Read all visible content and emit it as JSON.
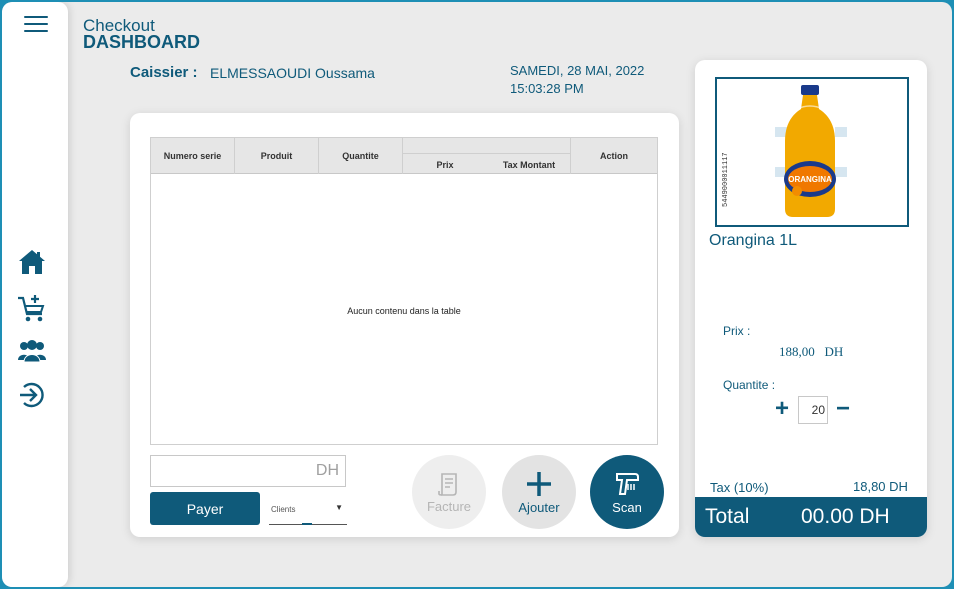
{
  "header": {
    "title_small": "Checkout",
    "title_big": "DASHBOARD",
    "cashier_label": "Caissier :",
    "cashier_name": "ELMESSAOUDI Oussama",
    "date": "SAMEDI, 28 MAI, 2022",
    "time": "15:03:28 PM"
  },
  "sidebar": {
    "items": [
      {
        "icon": "menu-icon"
      },
      {
        "icon": "home-icon"
      },
      {
        "icon": "cart-add-icon"
      },
      {
        "icon": "users-icon"
      },
      {
        "icon": "logout-icon"
      }
    ]
  },
  "table": {
    "columns": [
      "Numero serie",
      "Produit",
      "Quantite",
      "Prix",
      "Tax Montant",
      "Action"
    ],
    "empty_message": "Aucun contenu dans la table"
  },
  "payment": {
    "total_placeholder": "DH",
    "pay_label": "Payer",
    "clients_label": "Clients"
  },
  "actions": {
    "facture_label": "Facture",
    "ajouter_label": "Ajouter",
    "scan_label": "Scan"
  },
  "product": {
    "name": "Orangina 1L",
    "image_icon": "orangina-bottle-image",
    "barcode_text": "5449000011117",
    "prix_label": "Prix :",
    "prix_value": "188,00",
    "prix_currency": "DH",
    "quantite_label": "Quantite :",
    "quantite_value": "20",
    "tax_label": "Tax (10%)",
    "tax_value": "18,80 DH",
    "total_label": "Total",
    "total_value": "00.00 DH"
  },
  "colors": {
    "primary": "#0f5a7a",
    "border": "#1e8fb5",
    "background": "#ebebeb"
  }
}
